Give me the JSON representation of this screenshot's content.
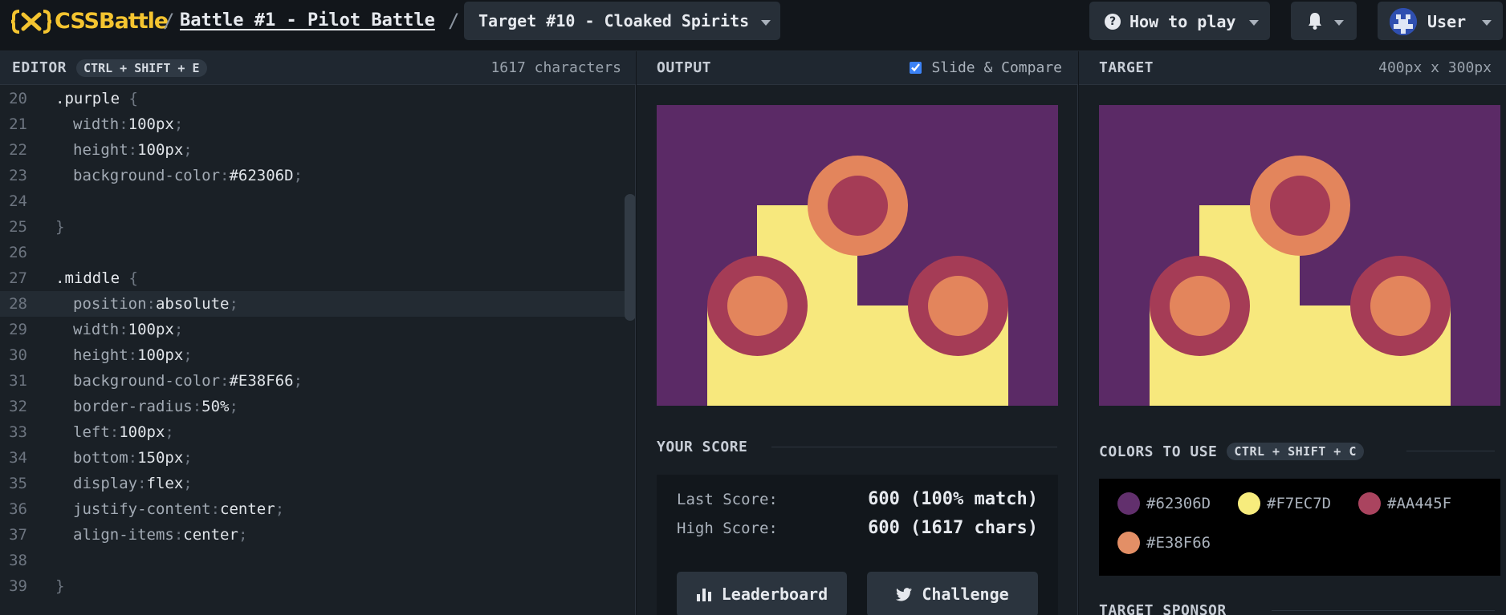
{
  "app": {
    "logo_text": "CSSBattle"
  },
  "breadcrumb": {
    "separator": "/",
    "battle": "Battle #1 - Pilot Battle",
    "target": "Target #10 - Cloaked Spirits"
  },
  "nav": {
    "how_to_play": "How to play",
    "user": "User"
  },
  "editor": {
    "title": "EDITOR",
    "shortcut": "CTRL + SHIFT + E",
    "char_count": "1617 characters",
    "lines": [
      {
        "n": "20",
        "sel": ".purple",
        "brace": "{"
      },
      {
        "n": "21",
        "prop": "width",
        "val": "100px"
      },
      {
        "n": "22",
        "prop": "height",
        "val": "100px"
      },
      {
        "n": "23",
        "prop": "background-color",
        "val": "#62306D"
      },
      {
        "n": "24"
      },
      {
        "n": "25",
        "close": "}"
      },
      {
        "n": "26"
      },
      {
        "n": "27",
        "sel": ".middle",
        "brace": "{"
      },
      {
        "n": "28",
        "prop": "position",
        "val": "absolute"
      },
      {
        "n": "29",
        "prop": "width",
        "val": "100px"
      },
      {
        "n": "30",
        "prop": "height",
        "val": "100px"
      },
      {
        "n": "31",
        "prop": "background-color",
        "val": "#E38F66"
      },
      {
        "n": "32",
        "prop": "border-radius",
        "val": "50%"
      },
      {
        "n": "33",
        "prop": "left",
        "val": "100px"
      },
      {
        "n": "34",
        "prop": "bottom",
        "val": "150px"
      },
      {
        "n": "35",
        "prop": "display",
        "val": "flex"
      },
      {
        "n": "36",
        "prop": "justify-content",
        "val": "center"
      },
      {
        "n": "37",
        "prop": "align-items",
        "val": "center"
      },
      {
        "n": "38"
      },
      {
        "n": "39",
        "close": "}"
      }
    ]
  },
  "output": {
    "title": "OUTPUT",
    "slide_compare_label": "Slide & Compare",
    "slide_compare_checked": true
  },
  "score": {
    "title": "YOUR SCORE",
    "last_label": "Last Score:",
    "last_value": "600 (100% match)",
    "high_label": "High Score:",
    "high_value": "600 (1617 chars)",
    "leaderboard_label": "Leaderboard",
    "challenge_label": "Challenge"
  },
  "target": {
    "title": "TARGET",
    "size": "400px x 300px",
    "colors_title": "COLORS TO USE",
    "colors_shortcut": "CTRL + SHIFT + C",
    "colors": [
      "#62306D",
      "#F7EC7D",
      "#AA445F",
      "#E38F66"
    ],
    "sponsor_title": "TARGET SPONSOR"
  },
  "theme": {
    "accent": "#f4c430",
    "purple": "#5b2a66",
    "yellow": "#f7e87d",
    "ring_red": "#a53c56",
    "ring_orange": "#e3855c"
  }
}
